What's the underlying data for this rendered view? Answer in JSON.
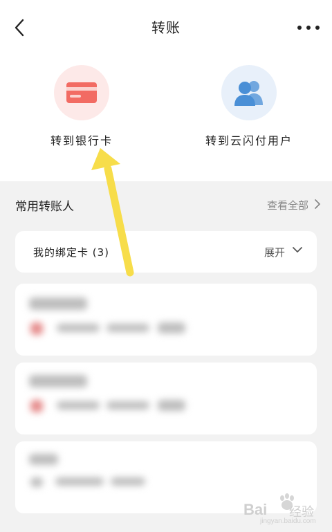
{
  "nav": {
    "title": "转账"
  },
  "actions": [
    {
      "label": "转到银行卡",
      "icon": "bank-card-icon",
      "icon_color": "#f26b63",
      "bg_color": "#fde9e8"
    },
    {
      "label": "转到云闪付用户",
      "icon": "users-icon",
      "icon_color": "#4a8fd6",
      "bg_color": "#e8f0fa"
    }
  ],
  "section": {
    "title": "常用转账人",
    "view_all": "查看全部"
  },
  "bound_cards": {
    "label": "我的绑定卡 (3)",
    "expand": "展开"
  },
  "arrow_color": "#f7dd4a",
  "watermark": {
    "brand": "Bai",
    "suffix": "经验",
    "url": "jingyan.baidu.com"
  }
}
